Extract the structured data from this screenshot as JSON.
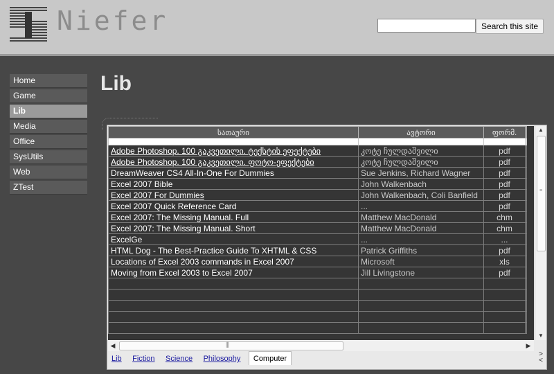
{
  "header": {
    "logo_text": "Niefer",
    "search_placeholder": "",
    "search_button": "Search this site"
  },
  "sidebar": {
    "items": [
      {
        "label": "Home",
        "active": false
      },
      {
        "label": "Game",
        "active": false
      },
      {
        "label": "Lib",
        "active": true
      },
      {
        "label": "Media",
        "active": false
      },
      {
        "label": "Office",
        "active": false
      },
      {
        "label": "SysUtils",
        "active": false
      },
      {
        "label": "Web",
        "active": false
      },
      {
        "label": "ZTest",
        "active": false
      }
    ]
  },
  "page": {
    "title": "Lib"
  },
  "table": {
    "columns": [
      "სათაური",
      "ავტორი",
      "ფორმ."
    ],
    "rows": [
      {
        "title": "Adobe Photoshop. 100 გაკვეთილი. ტექსტის ეფექტები",
        "author": "კოტე ჩულდაშვილი",
        "format": "pdf",
        "link": true
      },
      {
        "title": "Adobe Photoshop. 100 გაკვეთილი. ფოტო-ეფექტები",
        "author": "კოტე ჩულდაშვილი",
        "format": "pdf",
        "link": true
      },
      {
        "title": "DreamWeaver CS4 All-In-One For Dummies",
        "author": "Sue Jenkins, Richard Wagner",
        "format": "pdf",
        "link": false
      },
      {
        "title": "Excel 2007 Bible",
        "author": "John Walkenbach",
        "format": "pdf",
        "link": false
      },
      {
        "title": "Excel 2007 For Dummies",
        "author": "John Walkenbach, Coli Banfield",
        "format": "pdf",
        "link": true,
        "wrap": true
      },
      {
        "title": "Excel 2007 Quick Reference Card",
        "author": "...",
        "format": "pdf",
        "link": false
      },
      {
        "title": "Excel 2007: The Missing Manual. Full",
        "author": "Matthew MacDonald",
        "format": "chm",
        "link": false
      },
      {
        "title": "Excel 2007: The Missing Manual. Short",
        "author": "Matthew MacDonald",
        "format": "chm",
        "link": false
      },
      {
        "title": "ExcelGe",
        "author": "...",
        "format": "...",
        "link": false
      },
      {
        "title": "HTML Dog - The Best-Practice Guide To XHTML & CSS",
        "author": "Patrick Griffiths",
        "format": "pdf",
        "link": false
      },
      {
        "title": "Locations of Excel 2003 commands in Excel 2007",
        "author": "Microsoft",
        "format": "xls",
        "link": false
      },
      {
        "title": "Moving from Excel 2003 to Excel 2007",
        "author": "Jill Livingstone",
        "format": "pdf",
        "link": false
      }
    ]
  },
  "tabs": [
    {
      "label": "Lib",
      "active": false
    },
    {
      "label": "Fiction",
      "active": false
    },
    {
      "label": "Science",
      "active": false
    },
    {
      "label": "Philosophy",
      "active": false
    },
    {
      "label": "Computer",
      "active": true
    }
  ],
  "icons": {
    "scroll_up": "scroll-up-arrow-icon",
    "scroll_down": "scroll-down-arrow-icon",
    "scroll_left": "scroll-left-arrow-icon",
    "scroll_right": "scroll-right-arrow-icon",
    "tab_next": "tab-next-icon",
    "tab_prev": "tab-prev-icon"
  },
  "colors": {
    "background": "#474747",
    "header": "#c8c8c8",
    "active_nav": "#9a9a9a",
    "grid_background": "#353535"
  }
}
